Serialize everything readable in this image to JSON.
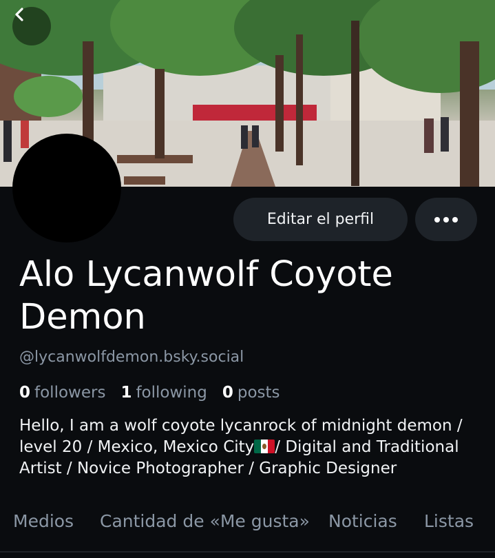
{
  "banner": {
    "image_description_icon": "city-plaza-banner",
    "back_icon": "chevron-left-icon"
  },
  "actions": {
    "edit_label": "Editar el perfil",
    "more_icon": "ellipsis-icon"
  },
  "profile": {
    "display_name": "Alo Lycanwolf Coyote Demon",
    "handle": "@lycanwolfdemon.bsky.social",
    "stats": {
      "followers_count": "0",
      "followers_label": "followers",
      "following_count": "1",
      "following_label": "following",
      "posts_count": "0",
      "posts_label": "posts"
    },
    "bio_part1": "Hello, I am a wolf coyote lycanrock of midnight demon / level 20 / Mexico, Mexico City",
    "bio_flag_icon": "mexico-flag-icon",
    "bio_part2": "/ Digital and Traditional Artist / Novice Photographer / Graphic Designer"
  },
  "tabs": [
    {
      "label": "Medios"
    },
    {
      "label": "Cantidad de «Me gusta»"
    },
    {
      "label": "Noticias"
    },
    {
      "label": "Listas"
    }
  ],
  "colors": {
    "background": "#0a0c0f",
    "button_bg": "#1e2329",
    "muted_text": "#8b97a5"
  }
}
